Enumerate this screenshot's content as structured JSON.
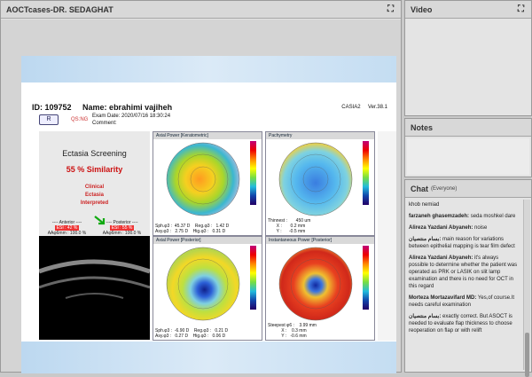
{
  "main": {
    "title": "AOCTcases-DR. SEDAGHAT"
  },
  "video": {
    "title": "Video"
  },
  "notes": {
    "title": "Notes"
  },
  "chat": {
    "title": "Chat",
    "scope": "(Everyone)",
    "messages": [
      {
        "author": "",
        "text": "khob nemiad"
      },
      {
        "author": "farzaneh ghasemzadeh:",
        "text": "seda moshkel dare"
      },
      {
        "author": "Alireza Yazdani Abyaneh:",
        "text": "noise"
      },
      {
        "author": "بسام منتصیان:",
        "text": "main reason for variations between epithelial mapping is tear film defect"
      },
      {
        "author": "Alireza Yazdani Abyaneh:",
        "text": "it's always possible to determine whether the patient was operated as PRK or LASIK on slit lamp examination and there is no need for OCT in this regard"
      },
      {
        "author": "Morteza Mortazavifard MD:",
        "text": "Yes,of course.It needs careful examination"
      },
      {
        "author": "بسام منتصیان:",
        "text": "exactly correct. But ASOCT is needed to evaluate flap thickness to choose reoperation on flap or with relift"
      }
    ]
  },
  "report": {
    "id": "ID: 109752",
    "name": "Name:  ebrahimi vajiheh",
    "device": "CASIA2",
    "version": "Ver.38.1",
    "qs": "QS:NG",
    "logo": "R",
    "exam_date": "Exam Date: 2020/07/16 18:30:24",
    "comment": "Comment:",
    "ectasia_title": "Ectasia Screening",
    "similarity": "55 % Similarity",
    "result1": "Clinical",
    "result2": "Ectasia",
    "result3": "Interpreted",
    "anterior_label": "---- Anterior ----",
    "anterior_esi": "ESI : 42 %",
    "anterior_aa": "AAφ6mm : 100.0 %",
    "posterior_label": "---- Posterior ----",
    "posterior_esi": "ESI : 55 %",
    "posterior_aa": "AAφ6mm : 100.0 %",
    "maps": [
      {
        "title": "Axial Power [Keratometric]",
        "footer": "Sph.φ3 :  45.37 D    Reg.φ3 :   1.42 D\nAsy.φ3 :   2.75 D    Hig.φ3 :   0.31 D"
      },
      {
        "title": "Pachymetry",
        "footer": "Thinnest :       450 um\n       X :       0.2 mm\n       Y :      -0.5 mm"
      },
      {
        "title": "Axial Power [Posterior]",
        "footer": "Sph.φ3 :  -6.90 D    Reg.φ3 :   0.21 D\nAsy.φ3 :   0.27 D    Hig.φ3 :   0.06 D"
      },
      {
        "title": "Instantaneous Power [Posterior]",
        "footer": "Steepest φ6 :    3.99 mm\n           X :    0.3 mm\n           Y :   -0.6 mm"
      }
    ]
  }
}
